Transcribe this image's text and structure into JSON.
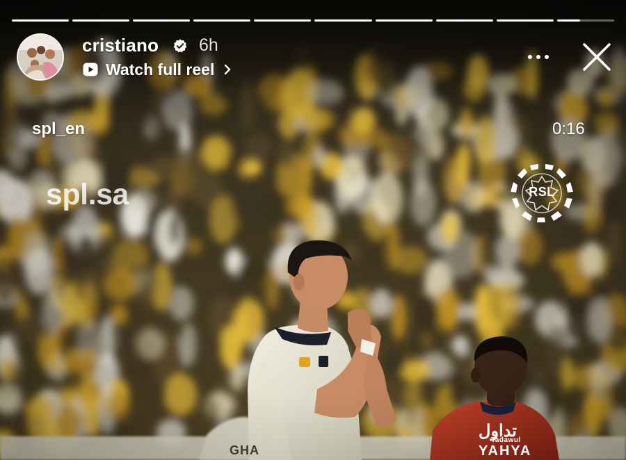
{
  "story": {
    "segments_total": 10,
    "segments_complete": 9,
    "current_segment_progress": 0.4
  },
  "header": {
    "username": "cristiano",
    "verified": true,
    "time_ago": "6h",
    "reel_link_label": "Watch full reel"
  },
  "video": {
    "source_handle": "spl_en",
    "elapsed": "0:16",
    "watermark": "spl.sa",
    "logo_text": "RSL"
  },
  "jerseys": {
    "player_back_left": "GHA",
    "sponsor_arabic": "تداول",
    "sponsor_latin": "Tadawul",
    "player_name_right": "YAHYA"
  },
  "icons": {
    "verified": "verified-badge-icon",
    "reel": "play-reel-icon",
    "chevron": "chevron-right-icon",
    "more": "more-options-icon",
    "close": "close-icon"
  },
  "colors": {
    "crowd_yellow": "#d4a626",
    "home_kit": "#e9e6d6",
    "away_kit": "#c0392b",
    "verified_badge": "#ffffff"
  }
}
